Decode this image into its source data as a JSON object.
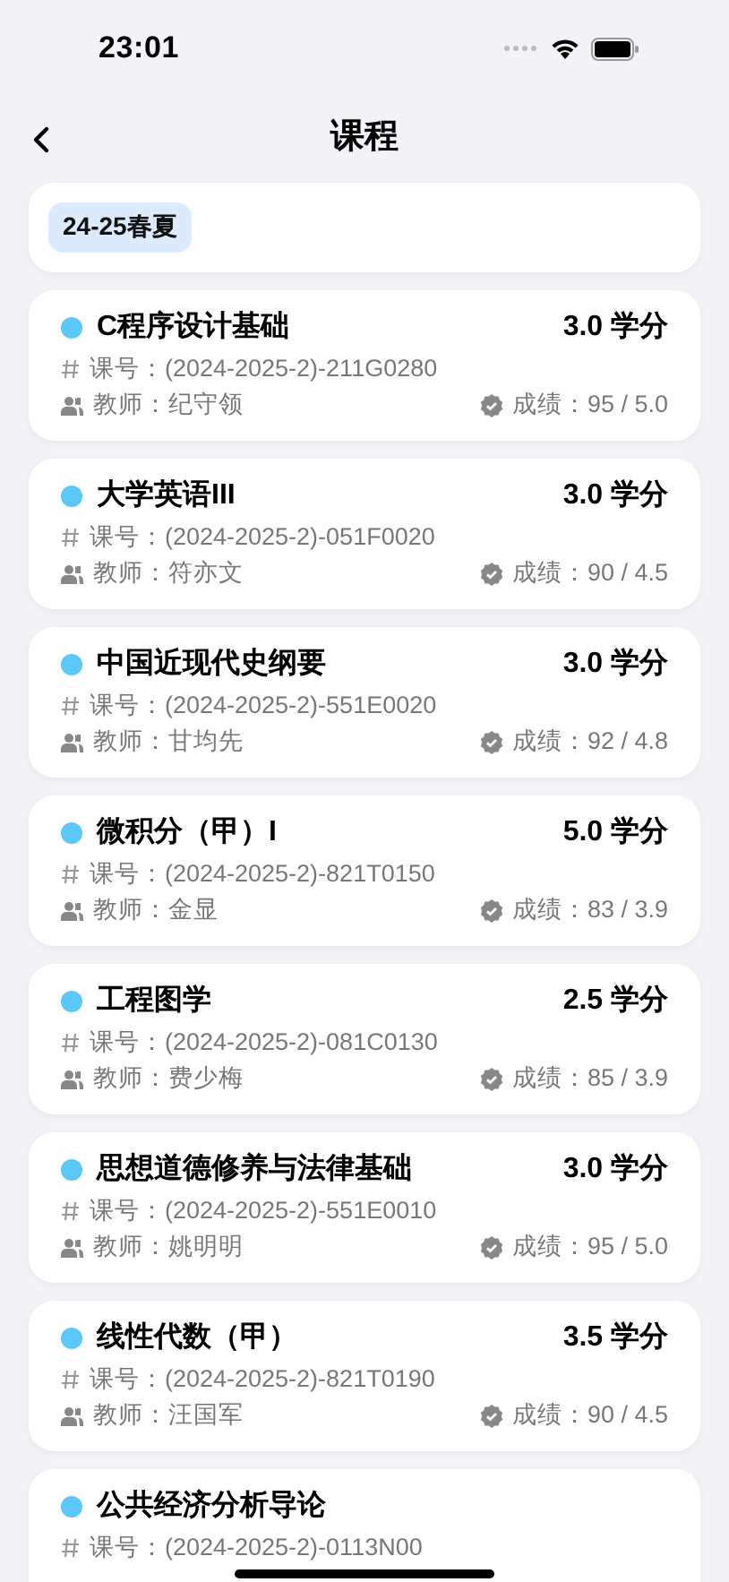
{
  "status_bar": {
    "time": "23:01"
  },
  "nav": {
    "title": "课程"
  },
  "semesters": [
    {
      "label": "24-25春夏",
      "selected": true
    }
  ],
  "courses": [
    {
      "name": "C程序设计基础",
      "color": "#5ac8fa",
      "credits": "3.0 学分",
      "code": "课号：(2024-2025-2)-211G0280",
      "teacher": "教师：纪守领",
      "grade": "成绩：95 / 5.0"
    },
    {
      "name": "大学英语III",
      "color": "#5ac8fa",
      "credits": "3.0 学分",
      "code": "课号：(2024-2025-2)-051F0020",
      "teacher": "教师：符亦文",
      "grade": "成绩：90 / 4.5"
    },
    {
      "name": "中国近现代史纲要",
      "color": "#5ac8fa",
      "credits": "3.0 学分",
      "code": "课号：(2024-2025-2)-551E0020",
      "teacher": "教师：甘均先",
      "grade": "成绩：92 / 4.8"
    },
    {
      "name": "微积分（甲）I",
      "color": "#5ac8fa",
      "credits": "5.0 学分",
      "code": "课号：(2024-2025-2)-821T0150",
      "teacher": "教师：金显",
      "grade": "成绩：83 / 3.9"
    },
    {
      "name": "工程图学",
      "color": "#5ac8fa",
      "credits": "2.5 学分",
      "code": "课号：(2024-2025-2)-081C0130",
      "teacher": "教师：费少梅",
      "grade": "成绩：85 / 3.9"
    },
    {
      "name": "思想道德修养与法律基础",
      "color": "#5ac8fa",
      "credits": "3.0 学分",
      "code": "课号：(2024-2025-2)-551E0010",
      "teacher": "教师：姚明明",
      "grade": "成绩：95 / 5.0"
    },
    {
      "name": "线性代数（甲）",
      "color": "#5ac8fa",
      "credits": "3.5 学分",
      "code": "课号：(2024-2025-2)-821T0190",
      "teacher": "教师：汪国军",
      "grade": "成绩：90 / 4.5"
    },
    {
      "name": "公共经济分析导论",
      "color": "#5ac8fa",
      "code": "课号：(2024-2025-2)-0113N00"
    }
  ]
}
